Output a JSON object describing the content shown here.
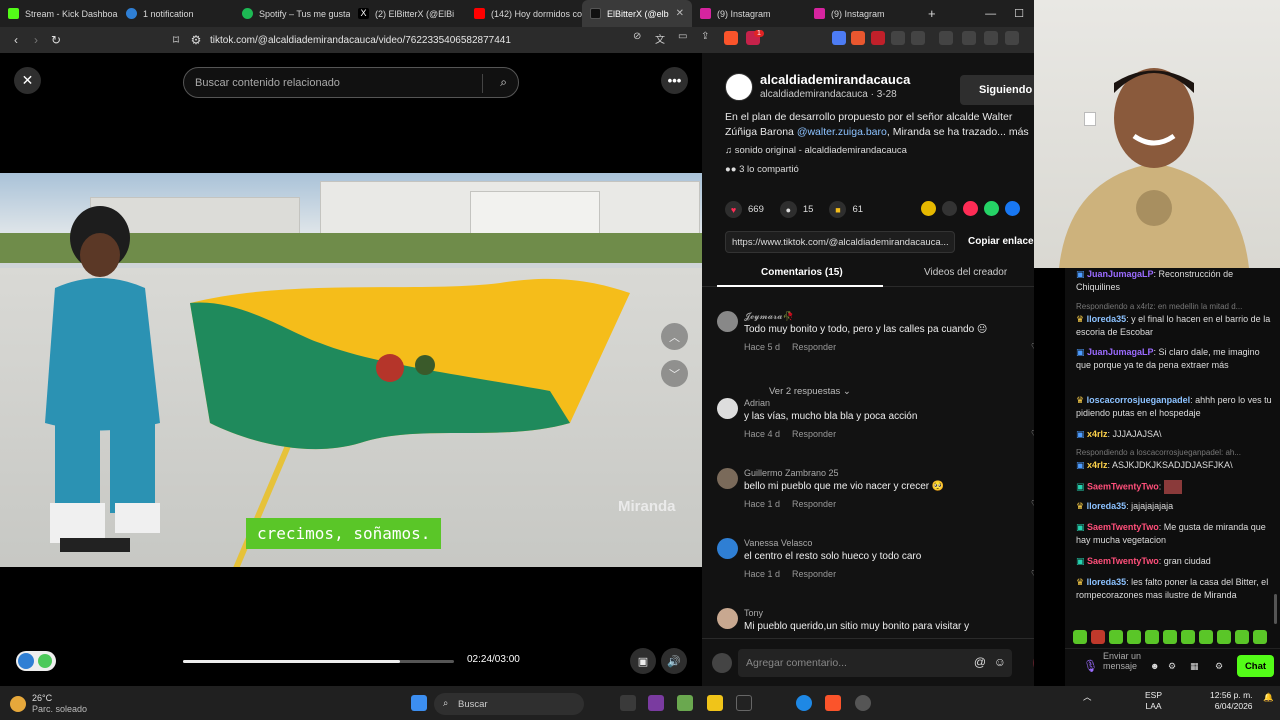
{
  "browser": {
    "tabs": [
      {
        "label": "Stream - Kick Dashboa",
        "color": "#53fc18",
        "active": false
      },
      {
        "label": "1 notification",
        "color": "#2f7fd4",
        "active": false
      },
      {
        "label": "Spotify – Tus me gusta",
        "color": "#1db954",
        "active": false
      },
      {
        "label": "(2) ElBitterX (@ElBi",
        "color": "#cccccc",
        "active": false
      },
      {
        "label": "(142) Hoy dormidos co",
        "color": "#ff0000",
        "active": false
      },
      {
        "label": "ElBitterX (@elb",
        "color": "#ffffff",
        "active": true
      },
      {
        "label": "(9) Instagram",
        "color": "#d6249f",
        "active": false
      },
      {
        "label": "(9) Instagram",
        "color": "#d6249f",
        "active": false
      }
    ],
    "new_tab": "+",
    "url": "tiktok.com/@alcaldiademirandacauca/video/7622335406582877441",
    "brave_badge": "1"
  },
  "video": {
    "search_placeholder": "Buscar contenido relacionado",
    "caption": "crecimos, soñamos.",
    "watermark": "Miranda",
    "time": "02:24/03:00",
    "progress": 0.8
  },
  "post": {
    "username": "alcaldiademirandacauca",
    "subline": "alcaldiademirandacauca · 3-28",
    "follow_label": "Siguiendo",
    "description_pre": "En el plan de desarrollo propuesto por el señor alcalde Walter Zúñiga Barona ",
    "description_mention": "@walter.zuiga.baro",
    "description_post": ", Miranda se ha trazado... más",
    "sound": "sonido original - alcaldiademirandacauca",
    "shared": "3 lo compartió",
    "likes": "669",
    "comments_count": "15",
    "saves": "61",
    "link": "https://www.tiktok.com/@alcaldiademirandacauca...",
    "copy_label": "Copiar enlace",
    "tab_comments": "Comentarios (15)",
    "tab_videos": "Videos del creador",
    "comment_placeholder": "Agregar comentario...",
    "reply_label": "Responder",
    "more_replies": "Ver 2 respuestas"
  },
  "comments": [
    {
      "name": "𝓙𝓮𝔂𝓶𝓪𝓻𝓪🥀",
      "text": "Todo muy bonito y todo, pero y las calles pa cuando 😐",
      "when": "Hace 5 d",
      "likes": "15",
      "color": "#888888"
    },
    {
      "name": "Adrian",
      "text": "y las vías, mucho bla bla y poca acción",
      "when": "Hace 4 d",
      "likes": "4",
      "color": "#dddddd"
    },
    {
      "name": "Guillermo Zambrano 25",
      "text": "bello mi pueblo que me vio nacer y crecer 🥺",
      "when": "Hace 1 d",
      "likes": "0",
      "color": "#7a6a5a"
    },
    {
      "name": "Vanessa Velasco",
      "text": "el centro el resto solo hueco y todo caro",
      "when": "Hace 1 d",
      "likes": "0",
      "color": "#2f7fd4"
    },
    {
      "name": "Tony",
      "text": "Mi pueblo querido,un sitio muy bonito para visitar y",
      "when": "",
      "likes": "",
      "color": "#c8a890"
    }
  ],
  "chat": {
    "messages": [
      {
        "user": "JuanJumagaLP",
        "text": ": Reconstrucción de Chiquilines",
        "ucolor": "#9b6bff"
      },
      {
        "reply": "Respondiendo a x4rlz: en medellin la mitad d..."
      },
      {
        "user": "lloreda35",
        "text": ": y el final lo hacen en el barrio de la escoria de Escobar",
        "ucolor": "#8cc2ff"
      },
      {
        "user": "JuanJumagaLP",
        "text": ": Si claro dale, me imagino que porque ya te da pena extraer más",
        "ucolor": "#9b6bff"
      },
      {
        "user": "loscacorrosjueganpadel",
        "text": ": ahhh pero lo ves tu pidiendo putas en el hospedaje",
        "ucolor": "#8cc2ff"
      },
      {
        "user": "x4rlz",
        "text": ": JJJAJAJSA\\",
        "ucolor": "#ffd24a"
      },
      {
        "reply": "Respondiendo a loscacorrosjueganpadel: ah..."
      },
      {
        "user": "x4rlz",
        "text": ": ASJKJDKJKSADJDJASFJKA\\",
        "ucolor": "#ffd24a"
      },
      {
        "user": "SaemTwentyTwo",
        "text": ":",
        "ucolor": "#ff4f7a"
      },
      {
        "user": "lloreda35",
        "text": ": jajajajajaja",
        "ucolor": "#8cc2ff"
      },
      {
        "user": "SaemTwentyTwo",
        "text": ": Me gusta de miranda que hay mucha vegetacion",
        "ucolor": "#ff4f7a"
      },
      {
        "user": "SaemTwentyTwo",
        "text": ": gran ciudad",
        "ucolor": "#ff4f7a"
      },
      {
        "user": "lloreda35",
        "text": ": les falto poner la casa del Bitter, el rompecorazones mas ilustre de Miranda",
        "ucolor": "#8cc2ff"
      }
    ],
    "input_placeholder": "Enviar un mensaje",
    "send_label": "Chat"
  },
  "taskbar": {
    "temp": "26°C",
    "weather": "Parc. soleado",
    "search": "Buscar",
    "lang": "ESP",
    "lang2": "LAA",
    "time": "12:56 p. m.",
    "date": "6/04/2026"
  }
}
